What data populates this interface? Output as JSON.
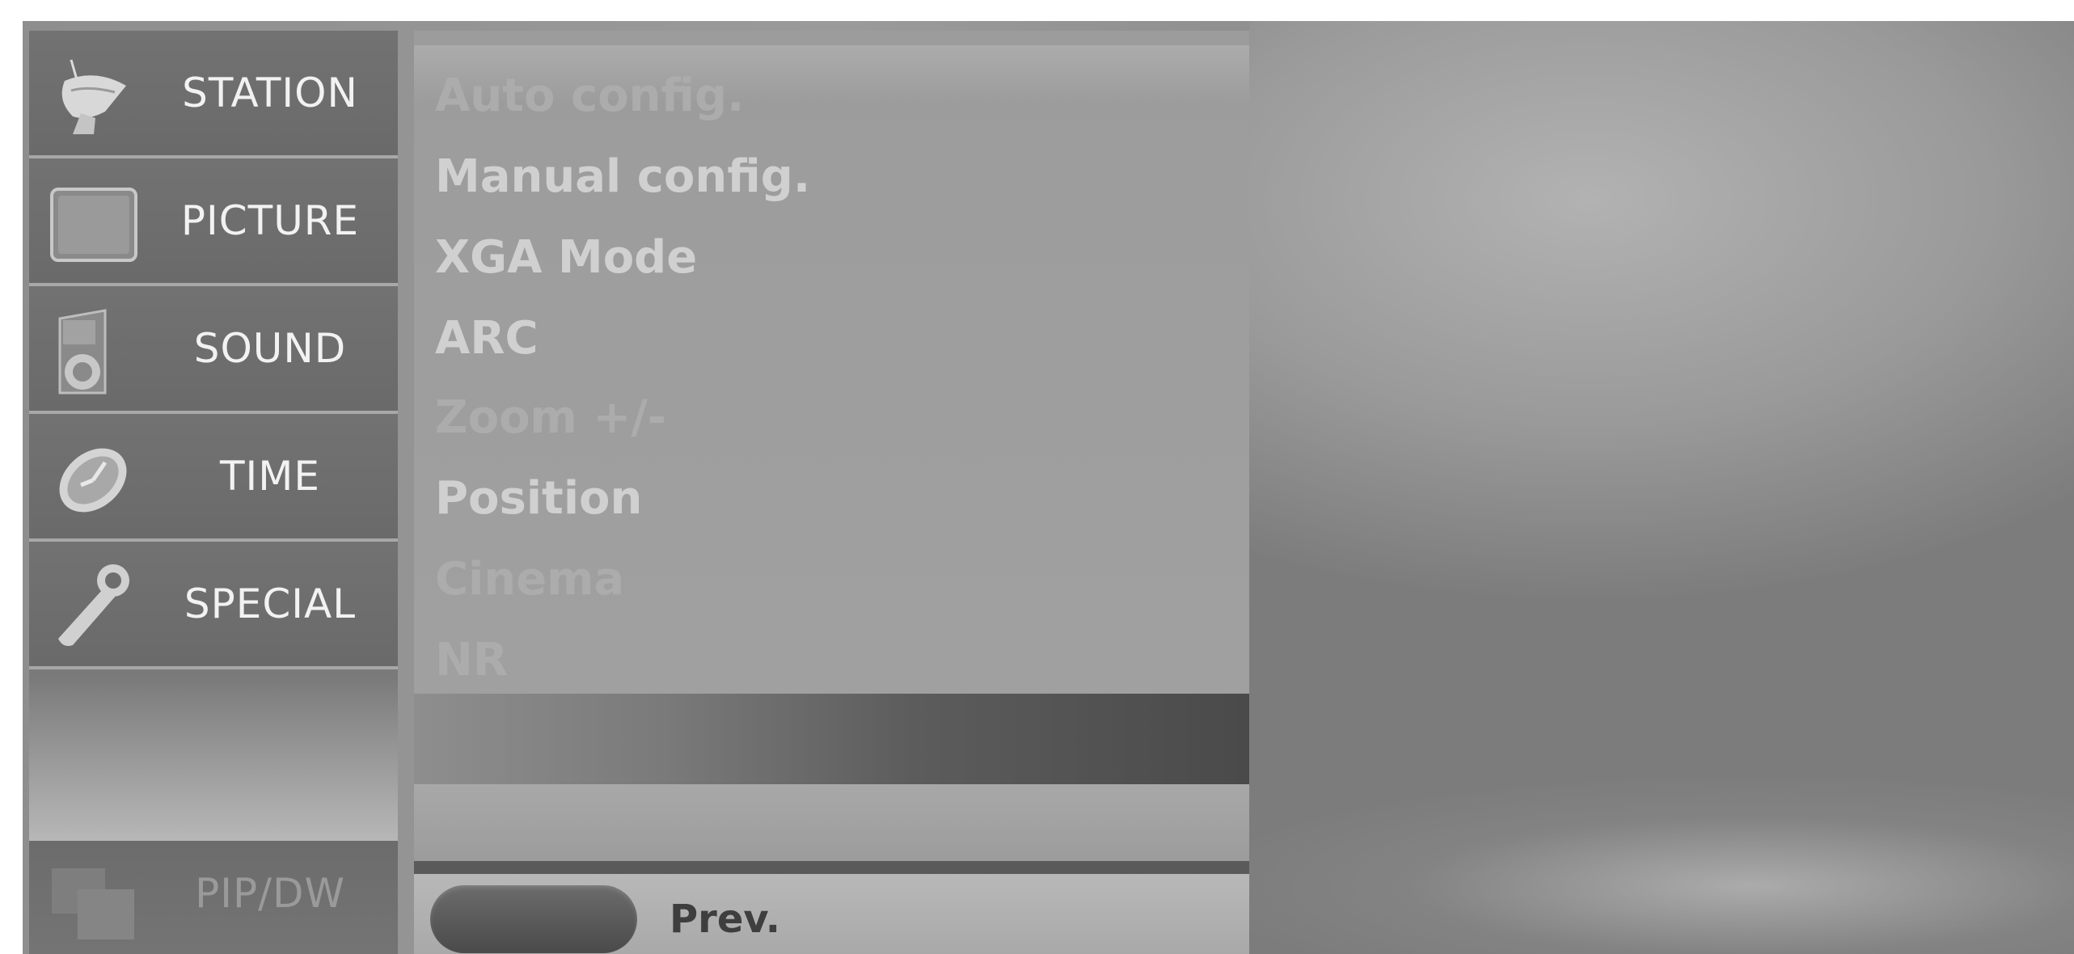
{
  "main_menu": {
    "items": [
      {
        "label": "STATION",
        "icon": "satellite-dish-icon"
      },
      {
        "label": "PICTURE",
        "icon": "picture-screen-icon"
      },
      {
        "label": "SOUND",
        "icon": "speaker-icon"
      },
      {
        "label": "TIME",
        "icon": "clock-icon"
      },
      {
        "label": "SPECIAL",
        "icon": "wrench-icon"
      }
    ],
    "pip": {
      "label": "PIP/DW",
      "icon": "pip-windows-icon"
    }
  },
  "sub_menu": {
    "items": [
      {
        "label": "Auto config."
      },
      {
        "label": "Manual config."
      },
      {
        "label": "XGA Mode"
      },
      {
        "label": "ARC"
      },
      {
        "label": "Zoom +/-"
      },
      {
        "label": "Position"
      },
      {
        "label": "Cinema"
      },
      {
        "label": "NR"
      }
    ]
  },
  "footer": {
    "prev_label": "Prev.",
    "prev_button_color": "#5a5a5a"
  }
}
